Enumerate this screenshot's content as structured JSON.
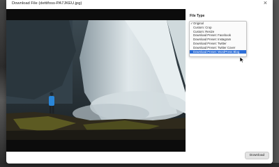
{
  "dialog": {
    "title": "Download File (dettifoss-PA7JKEU.jpg)",
    "close_icon": "close-icon"
  },
  "image": {
    "subject": "waterfall-photo"
  },
  "side_panel": {
    "file_type_label": "File Type",
    "selected_value": "Download Preset: WordPress Blog",
    "options": [
      {
        "label": "Original",
        "checked": true,
        "highlighted": false
      },
      {
        "label": "Custom: Crop",
        "checked": false,
        "highlighted": false
      },
      {
        "label": "Custom: Resize",
        "checked": false,
        "highlighted": false
      },
      {
        "label": "Download Preset: Facebook",
        "checked": false,
        "highlighted": false
      },
      {
        "label": "Download Preset: Instagram",
        "checked": false,
        "highlighted": false
      },
      {
        "label": "Download Preset: Twitter",
        "checked": false,
        "highlighted": false
      },
      {
        "label": "Download Preset: Twitter Cover",
        "checked": false,
        "highlighted": false
      },
      {
        "label": "Download Preset: WordPress Blog",
        "checked": false,
        "highlighted": true
      }
    ],
    "check_glyph": "✓"
  },
  "footer": {
    "download_label": "Download"
  },
  "colors": {
    "highlight": "#2e6fd8",
    "dialog_bg": "#ffffff",
    "overlay": "#3a3a3a"
  }
}
